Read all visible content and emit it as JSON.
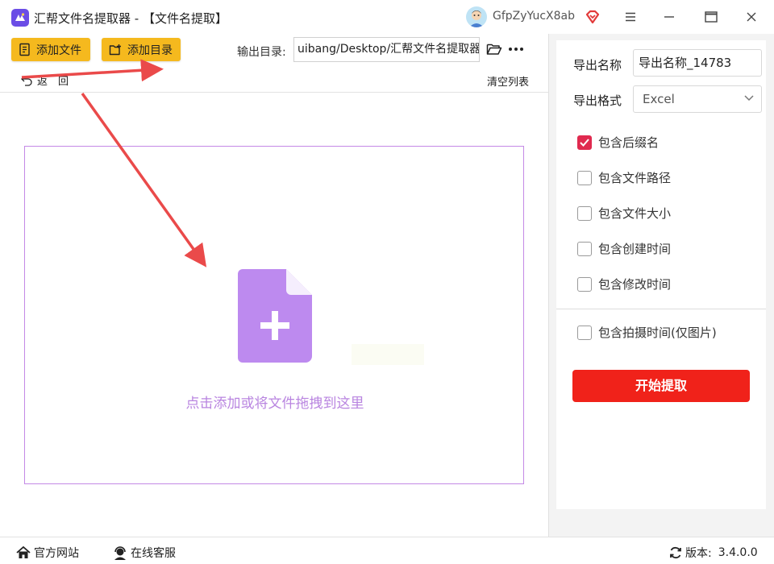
{
  "window": {
    "title": "汇帮文件名提取器 - 【文件名提取】",
    "user_name": "GfpZyYucX8ab"
  },
  "toolbar": {
    "add_file_label": "添加文件",
    "add_dir_label": "添加目录",
    "output_dir_label": "输出目录:",
    "output_dir_value": "uibang/Desktop/汇帮文件名提取器",
    "back_label": "返　回",
    "clear_list_label": "清空列表"
  },
  "dropzone": {
    "hint": "点击添加或将文件拖拽到这里"
  },
  "settings": {
    "export_name_label": "导出名称",
    "export_name_value": "导出名称_14783",
    "export_format_label": "导出格式",
    "export_format_value": "Excel",
    "options": [
      {
        "label": "包含后缀名",
        "checked": true
      },
      {
        "label": "包含文件路径",
        "checked": false
      },
      {
        "label": "包含文件大小",
        "checked": false
      },
      {
        "label": "包含创建时间",
        "checked": false
      },
      {
        "label": "包含修改时间",
        "checked": false
      },
      {
        "label": "包含拍摄时间(仅图片)",
        "checked": false
      }
    ],
    "start_label": "开始提取"
  },
  "footer": {
    "website_label": "官方网站",
    "support_label": "在线客服",
    "version_label": "版本:",
    "version_value": "3.4.0.0"
  },
  "colors": {
    "accent_yellow": "#f5b91e",
    "start_red": "#f0221a",
    "checkbox_red": "#e02a4f",
    "drop_purple": "#c489e6",
    "annotation_arrow": "#ea4a4a"
  }
}
